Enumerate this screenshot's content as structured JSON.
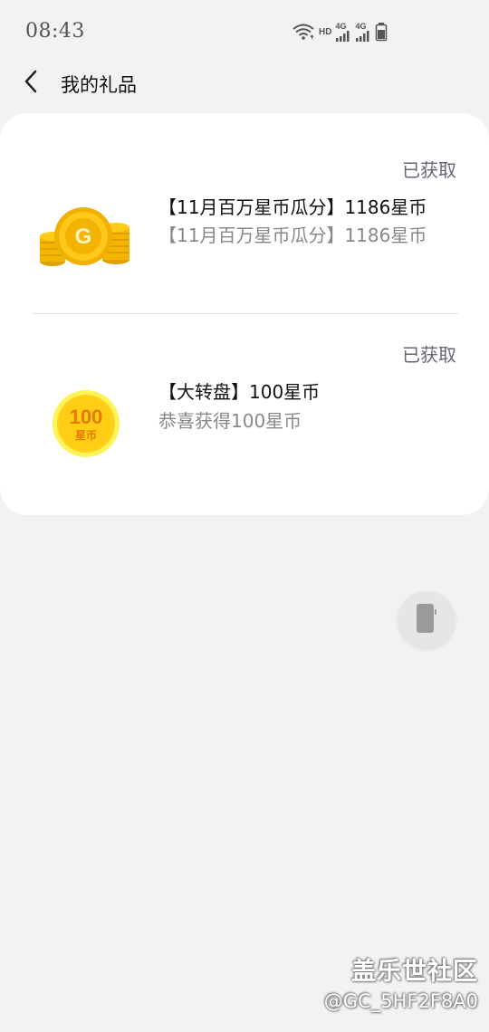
{
  "status_bar": {
    "time": "08:43",
    "icons": [
      "wifi-icon",
      "hd-icon",
      "signal-4g-icon",
      "signal-4g-icon",
      "battery-icon"
    ],
    "hd_label": "HD",
    "net_label_1": "4G",
    "net_label_2": "4G"
  },
  "header": {
    "back_icon": "chevron-left-icon",
    "title": "我的礼品"
  },
  "gifts": [
    {
      "status": "已获取",
      "title": "【11月百万星币瓜分】1186星币",
      "description": "【11月百万星币瓜分】1186星币",
      "icon": "gold-coin-stack-icon",
      "icon_letter": "G"
    },
    {
      "status": "已获取",
      "title": "【大转盘】100星币",
      "description": "恭喜获得100星币",
      "icon": "star-coin-100-icon",
      "coin_amount": "100",
      "coin_unit": "星币"
    }
  ],
  "floating_button": {
    "icon": "phone-icon"
  },
  "watermark": {
    "logo": "盖乐世社区",
    "user": "@GC_5HF2F8A0"
  },
  "colors": {
    "background": "#f2f2f2",
    "card": "#ffffff",
    "status_text": "#666677",
    "coin_gold": "#f5b800",
    "coin_yellow": "#ffe53b"
  }
}
